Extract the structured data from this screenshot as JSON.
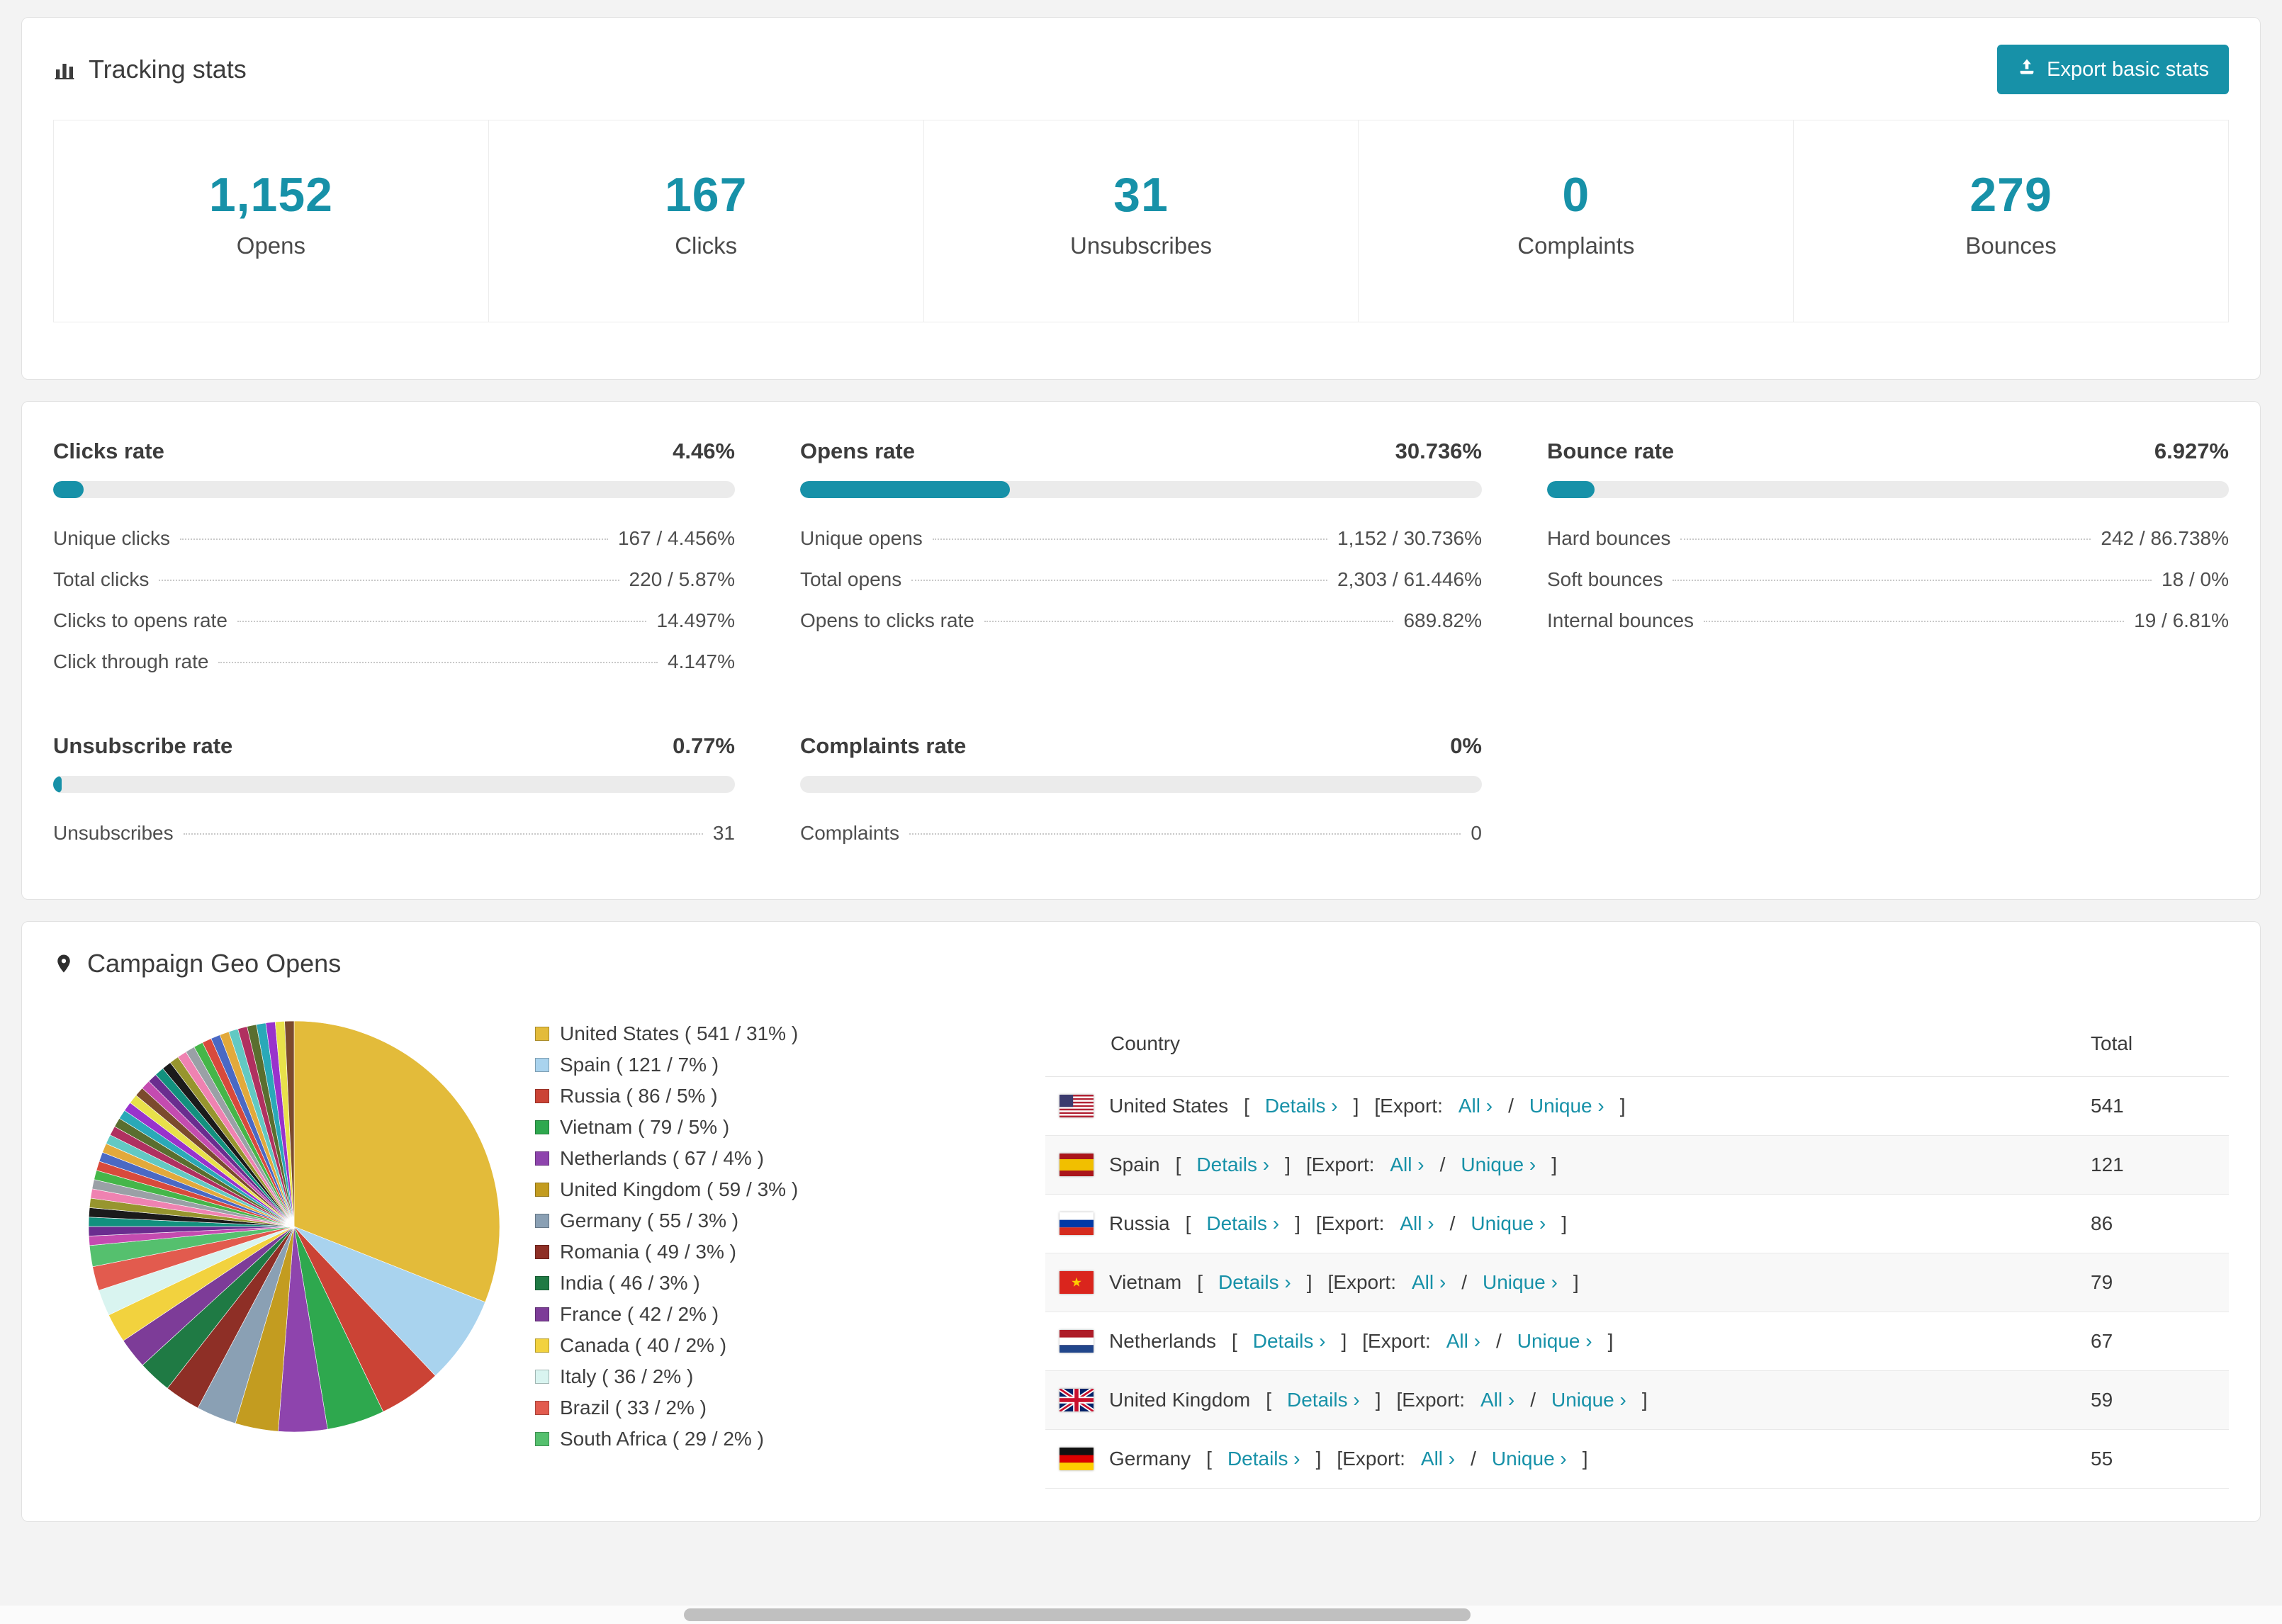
{
  "accent_color": "#1791a8",
  "tracking": {
    "title": "Tracking stats",
    "export_button": "Export basic stats",
    "stats": [
      {
        "value": "1,152",
        "label": "Opens"
      },
      {
        "value": "167",
        "label": "Clicks"
      },
      {
        "value": "31",
        "label": "Unsubscribes"
      },
      {
        "value": "0",
        "label": "Complaints"
      },
      {
        "value": "279",
        "label": "Bounces"
      }
    ]
  },
  "rates": [
    {
      "title": "Clicks rate",
      "value": "4.46%",
      "percent": 4.46,
      "rows": [
        {
          "label": "Unique clicks",
          "value": "167 / 4.456%"
        },
        {
          "label": "Total clicks",
          "value": "220 / 5.87%"
        },
        {
          "label": "Clicks to opens rate",
          "value": "14.497%"
        },
        {
          "label": "Click through rate",
          "value": "4.147%"
        }
      ]
    },
    {
      "title": "Opens rate",
      "value": "30.736%",
      "percent": 30.736,
      "rows": [
        {
          "label": "Unique opens",
          "value": "1,152 / 30.736%"
        },
        {
          "label": "Total opens",
          "value": "2,303 / 61.446%"
        },
        {
          "label": "Opens to clicks rate",
          "value": "689.82%"
        }
      ]
    },
    {
      "title": "Bounce rate",
      "value": "6.927%",
      "percent": 6.927,
      "rows": [
        {
          "label": "Hard bounces",
          "value": "242 / 86.738%"
        },
        {
          "label": "Soft bounces",
          "value": "18 / 0%"
        },
        {
          "label": "Internal bounces",
          "value": "19 / 6.81%"
        }
      ]
    },
    {
      "title": "Unsubscribe rate",
      "value": "0.77%",
      "percent": 0.77,
      "rows": [
        {
          "label": "Unsubscribes",
          "value": "31"
        }
      ]
    },
    {
      "title": "Complaints rate",
      "value": "0%",
      "percent": 0,
      "rows": [
        {
          "label": "Complaints",
          "value": "0"
        }
      ]
    }
  ],
  "geo": {
    "title": "Campaign Geo Opens",
    "table": {
      "headers": [
        "Country",
        "Total"
      ],
      "links": {
        "details": "Details ›",
        "export_prefix": "[Export:",
        "all": "All ›",
        "slash": "/",
        "unique": "Unique ›"
      },
      "rows": [
        {
          "country": "United States",
          "total": "541",
          "flag": "us"
        },
        {
          "country": "Spain",
          "total": "121",
          "flag": "es"
        },
        {
          "country": "Russia",
          "total": "86",
          "flag": "ru"
        },
        {
          "country": "Vietnam",
          "total": "79",
          "flag": "vn"
        },
        {
          "country": "Netherlands",
          "total": "67",
          "flag": "nl"
        },
        {
          "country": "United Kingdom",
          "total": "59",
          "flag": "gb"
        },
        {
          "country": "Germany",
          "total": "55",
          "flag": "de"
        }
      ]
    }
  },
  "chart_data": {
    "type": "pie",
    "title": "Campaign Geo Opens",
    "legend_position": "right",
    "slices": [
      {
        "name": "United States",
        "value": 541,
        "pct": 31,
        "color": "#e3bb3a"
      },
      {
        "name": "Spain",
        "value": 121,
        "pct": 7,
        "color": "#a9d3ee"
      },
      {
        "name": "Russia",
        "value": 86,
        "pct": 5,
        "color": "#cb4335"
      },
      {
        "name": "Vietnam",
        "value": 79,
        "pct": 5,
        "color": "#2ea84e"
      },
      {
        "name": "Netherlands",
        "value": 67,
        "pct": 4,
        "color": "#8e44ad"
      },
      {
        "name": "United Kingdom",
        "value": 59,
        "pct": 3,
        "color": "#c39c20"
      },
      {
        "name": "Germany",
        "value": 55,
        "pct": 3,
        "color": "#8aa0b4"
      },
      {
        "name": "Romania",
        "value": 49,
        "pct": 3,
        "color": "#8e2f26"
      },
      {
        "name": "India",
        "value": 46,
        "pct": 3,
        "color": "#1f7a44"
      },
      {
        "name": "France",
        "value": 42,
        "pct": 2,
        "color": "#7d3c98"
      },
      {
        "name": "Canada",
        "value": 40,
        "pct": 2,
        "color": "#f2d23e"
      },
      {
        "name": "Italy",
        "value": 36,
        "pct": 2,
        "color": "#d9f4f0"
      },
      {
        "name": "Brazil",
        "value": 33,
        "pct": 2,
        "color": "#e25b4e"
      },
      {
        "name": "South Africa",
        "value": 29,
        "pct": 2,
        "color": "#55c06e"
      }
    ],
    "others": {
      "value": 462,
      "slice_count": 36,
      "colors": [
        "#c44bb0",
        "#6a2d8f",
        "#12917e",
        "#1b1b1b",
        "#97952e",
        "#ef82b1",
        "#9aa0a6",
        "#45b649",
        "#d84a3c",
        "#4a69c4",
        "#e2a93b",
        "#62c9c3",
        "#b03060",
        "#5a6e2f",
        "#2aa9b8",
        "#9932cc",
        "#e8e14a",
        "#7b4a2d"
      ]
    }
  }
}
